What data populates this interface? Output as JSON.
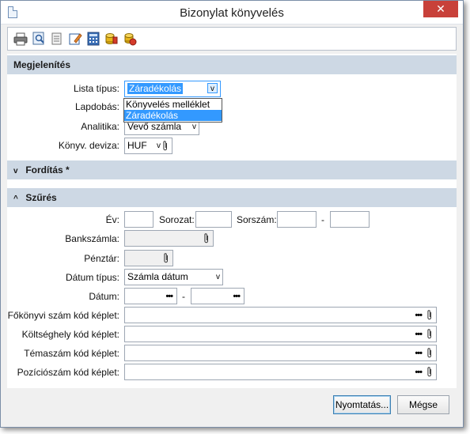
{
  "window": {
    "title": "Bizonylat könyvelés",
    "close_symbol": "✕"
  },
  "toolbar": {
    "buttons": [
      "printer-icon",
      "preview-icon",
      "settings-icon",
      "edit-icon",
      "calculator-icon",
      "coins-icon",
      "export-icon"
    ]
  },
  "sections": {
    "display": {
      "title": "Megjelenítés"
    },
    "translation": {
      "title": "Fordítás *",
      "chevron": "v"
    },
    "filter": {
      "title": "Szűrés",
      "chevron": "^"
    }
  },
  "display": {
    "list_type_label": "Lista típus:",
    "list_type_value": "Záradékolás",
    "list_type_options": [
      "Könyvelés melléklet",
      "Záradékolás"
    ],
    "page_break_label": "Lapdobás:",
    "analytics_label": "Analitika:",
    "analytics_value": "Vevő számla",
    "currency_label": "Könyv. deviza:",
    "currency_value": "HUF"
  },
  "filter": {
    "year_label": "Év:",
    "series_label": "Sorozat:",
    "serial_label": "Sorszám:",
    "serial_sep": "-",
    "bank_label": "Bankszámla:",
    "cash_label": "Pénztár:",
    "date_type_label": "Dátum típus:",
    "date_type_value": "Számla dátum",
    "date_label": "Dátum:",
    "date_sep": "-",
    "ledger_label": "Főkönyvi szám kód képlet:",
    "cost_center_label": "Költséghely kód képlet:",
    "topic_label": "Témaszám kód képlet:",
    "position_label": "Pozíciószám kód képlet:"
  },
  "footer": {
    "print_label": "Nyomtatás...",
    "cancel_label": "Mégse"
  },
  "colors": {
    "accent": "#3399ff",
    "section_header": "#cdd8e4",
    "close": "#c8413a"
  }
}
